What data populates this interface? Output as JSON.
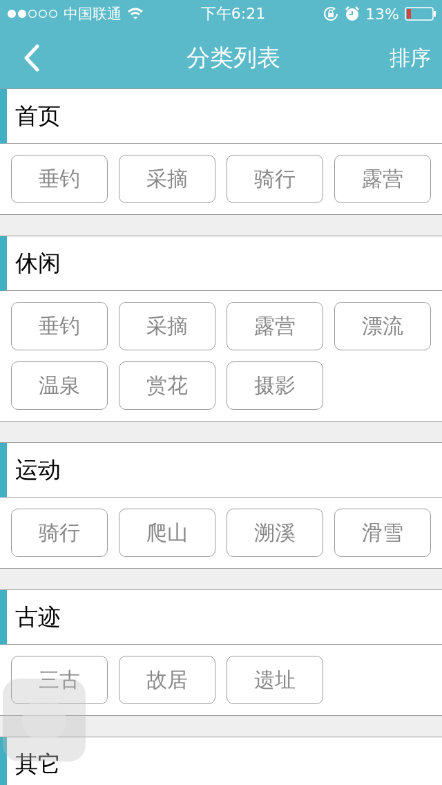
{
  "status_bar": {
    "carrier": "中国联通",
    "time": "下午6:21",
    "battery": "13%"
  },
  "nav": {
    "title": "分类列表",
    "action": "排序"
  },
  "sections": [
    {
      "title": "首页",
      "tags": [
        "垂钓",
        "采摘",
        "骑行",
        "露营"
      ]
    },
    {
      "title": "休闲",
      "tags": [
        "垂钓",
        "采摘",
        "露营",
        "漂流",
        "温泉",
        "赏花",
        "摄影"
      ]
    },
    {
      "title": "运动",
      "tags": [
        "骑行",
        "爬山",
        "溯溪",
        "滑雪"
      ]
    },
    {
      "title": "古迹",
      "tags": [
        "三古",
        "故居",
        "遗址"
      ]
    },
    {
      "title": "其它"
    }
  ]
}
